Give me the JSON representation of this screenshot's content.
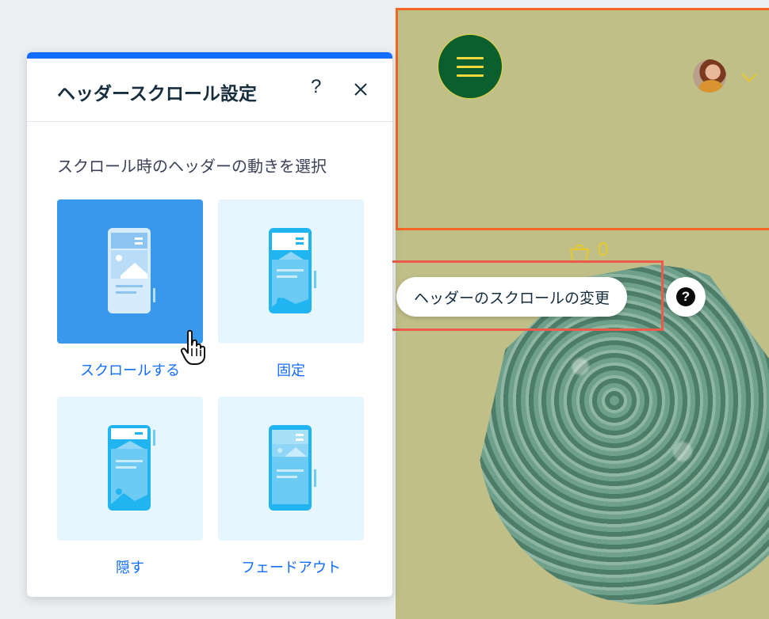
{
  "panel": {
    "title": "ヘッダースクロール設定",
    "help_label": "?",
    "subtitle": "スクロール時のヘッダーの動きを選択",
    "options": [
      {
        "label": "スクロールする",
        "selected": true
      },
      {
        "label": "固定",
        "selected": false
      },
      {
        "label": "隠す",
        "selected": false
      },
      {
        "label": "フェードアウト",
        "selected": false
      }
    ]
  },
  "preview": {
    "cart_count": "0",
    "hint_label": "ヘッダーのスクロールの変更",
    "help_symbol": "?"
  },
  "colors": {
    "accent": "#116dff",
    "selected_tile": "#3899ec",
    "tile_bg": "#e7f5fe",
    "site_bg": "#c0bf87",
    "header_outline": "#f26522",
    "hint_outline": "#ee5a4a",
    "menu_button": "#0b5e2e"
  },
  "icons": {
    "close": "close-icon",
    "menu": "hamburger-icon",
    "cart": "shopping-bag-icon",
    "chevron": "chevron-down-icon",
    "cursor": "pointer-hand-icon"
  }
}
